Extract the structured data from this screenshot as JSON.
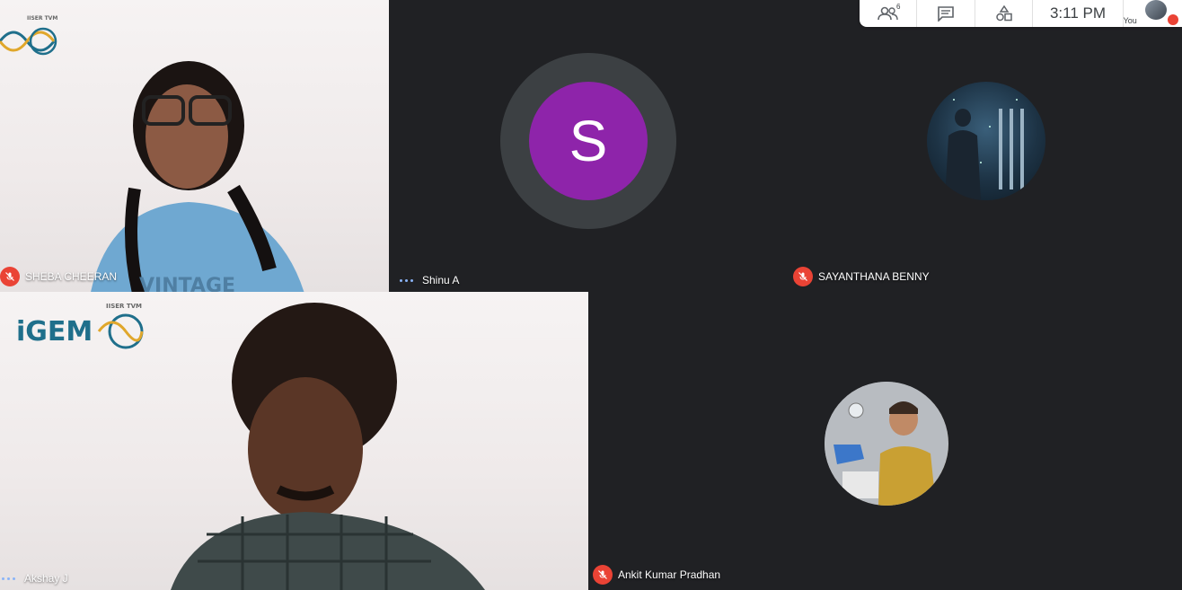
{
  "topbar": {
    "people_count": "6",
    "time": "3:11 PM",
    "self_label": "You"
  },
  "participants": [
    {
      "name": "SHEBA CHEERAN",
      "muted": true
    },
    {
      "name": "Shinu A",
      "muted": false,
      "speaking": true,
      "avatar_letter": "S",
      "avatar_color": "#8e24aa"
    },
    {
      "name": "SAYANTHANA BENNY",
      "muted": true
    },
    {
      "name": "Akshay J",
      "muted": false,
      "speaking": true
    },
    {
      "name": "Ankit Kumar Pradhan",
      "muted": true
    }
  ],
  "logo": {
    "text": "iGEM",
    "sub": "IISER TVM"
  },
  "colors": {
    "mute_red": "#ea4335",
    "background": "#202124",
    "speaking_dots": "#8ab4f8"
  }
}
